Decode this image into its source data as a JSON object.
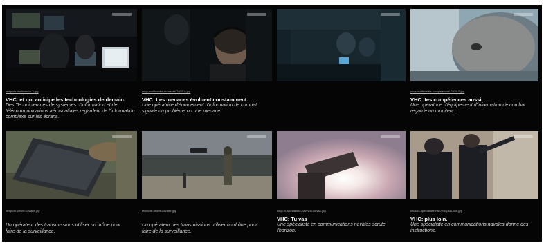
{
  "gallery": {
    "items": [
      {
        "filename": "tempote-multimedia-2.jpg",
        "title": "VHC: et qui anticipe les technologies de demain.",
        "description": "Des Technicien.nes de systèmes d'information et de télécommunications aérospatiales regardent de l'information complexe sur les écrans.",
        "scene": "cockpit-screens"
      },
      {
        "filename": "cnqc-multimedia-menaces-2025-0.jpg",
        "title": "VHC: Les menaces évoluent constamment.",
        "description": "Une opératrice d'équipement d'information de combat signale un problème ou une menace.",
        "scene": "operator-headset"
      },
      {
        "filename": "",
        "title": "",
        "description": "",
        "scene": "ship-bridge"
      },
      {
        "filename": "cnqc-multimedia-competences-2025-0.jpg",
        "title": "VHC: tes compétences aussi.",
        "description": "Une opératrice d'équipement d'information de combat regarde un moniteur.",
        "scene": "face-closeup"
      },
      {
        "filename": "tempote-onsite-ulivaite.jpg",
        "title": "",
        "description": "Un opérateur des transmissions utiliser un drône pour faire de la surveillance.",
        "scene": "laptop-field"
      },
      {
        "filename": "tempote-onsite-ulivaite.jpg",
        "title": "",
        "description": "Un opérateur des transmissions utiliser un drône pour faire de la surveillance.",
        "scene": "drone-forest"
      },
      {
        "filename": "cnqc-fc-specialiste-nav-vhc-tu-vas.jpg",
        "title": "VHC: Tu vas",
        "description": "Une spécialiste en communications navales scrute l'horizon.",
        "scene": "binoculars-sun"
      },
      {
        "filename": "cnqc-fc-specialiste-nav-vhc-plus-loin.jpg",
        "title": "VHC: plus loin.",
        "description": "Une spécialiste en communications navales donne des instructions.",
        "scene": "sailors-pointing"
      }
    ]
  },
  "colors": {
    "background": "#050505",
    "title": "#ffffff",
    "description": "#dcdcdc"
  }
}
